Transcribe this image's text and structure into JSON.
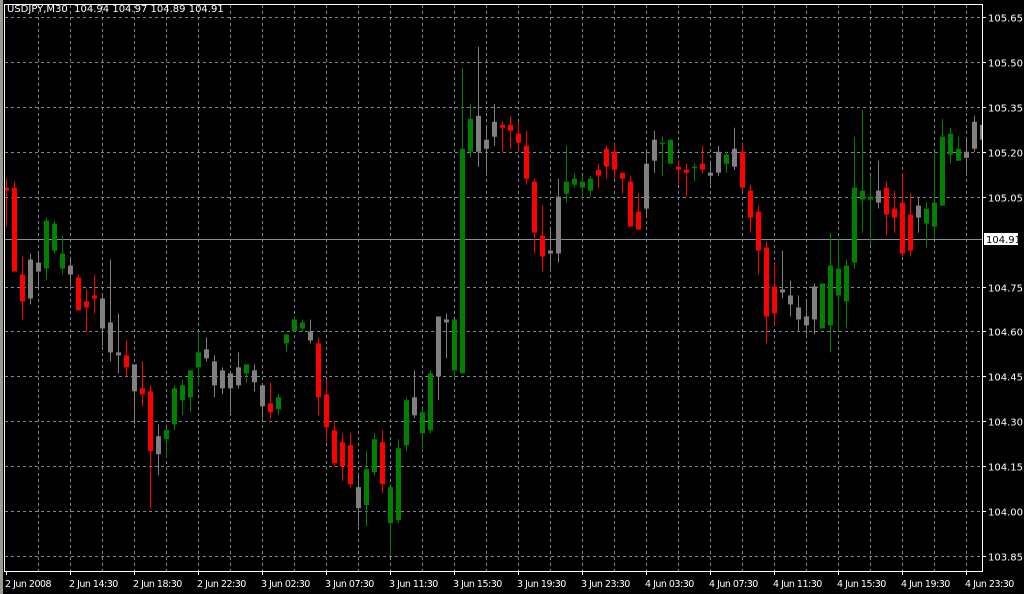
{
  "header": {
    "symbol": "USDJPY,M30",
    "open": "104.94",
    "high": "104.97",
    "low": "104.89",
    "close": "104.91"
  },
  "colors": {
    "bg": "#000000",
    "grid": "#778899",
    "frame": "#ffffff",
    "bull": "#008000",
    "bear": "#ff0000",
    "neutral": "#808080",
    "bid_line": "#8090a0"
  },
  "chart_data": {
    "type": "candlestick",
    "title": "USDJPY,M30",
    "ylim": [
      103.8,
      105.69
    ],
    "y_ticks": [
      "105.65",
      "105.50",
      "105.35",
      "105.20",
      "105.05",
      "104.75",
      "104.60",
      "104.45",
      "104.30",
      "104.15",
      "104.00",
      "103.85"
    ],
    "y_tick_values": [
      105.65,
      105.5,
      105.35,
      105.2,
      105.05,
      104.75,
      104.6,
      104.45,
      104.3,
      104.15,
      104.0,
      103.85
    ],
    "current_price": {
      "label": "104.91",
      "value": 104.91
    },
    "x_labels": [
      "2 Jun 2008",
      "2 Jun 14:30",
      "2 Jun 18:30",
      "2 Jun 22:30",
      "3 Jun 02:30",
      "3 Jun 07:30",
      "3 Jun 11:30",
      "3 Jun 15:30",
      "3 Jun 19:30",
      "3 Jun 23:30",
      "4 Jun 03:30",
      "4 Jun 07:30",
      "4 Jun 11:30",
      "4 Jun 15:30",
      "4 Jun 19:30",
      "4 Jun 23:30"
    ],
    "bars_per_label": 8,
    "grid": true,
    "candle_fields": [
      "open",
      "high",
      "low",
      "close",
      "color"
    ],
    "candles": [
      [
        105.08,
        105.11,
        104.95,
        105.07,
        "r"
      ],
      [
        105.08,
        105.1,
        104.8,
        104.8,
        "r"
      ],
      [
        104.79,
        104.85,
        104.64,
        104.7,
        "r"
      ],
      [
        104.84,
        104.86,
        104.69,
        104.71,
        "n"
      ],
      [
        104.83,
        104.86,
        104.75,
        104.8,
        "n"
      ],
      [
        104.81,
        104.98,
        104.77,
        104.97,
        "g"
      ],
      [
        104.87,
        104.97,
        104.86,
        104.96,
        "g"
      ],
      [
        104.81,
        104.92,
        104.79,
        104.86,
        "g"
      ],
      [
        104.82,
        104.84,
        104.75,
        104.79,
        "n"
      ],
      [
        104.78,
        104.79,
        104.67,
        104.67,
        "r"
      ],
      [
        104.7,
        104.74,
        104.6,
        104.68,
        "r"
      ],
      [
        104.72,
        104.79,
        104.66,
        104.71,
        "r"
      ],
      [
        104.71,
        104.72,
        104.55,
        104.61,
        "n"
      ],
      [
        104.63,
        104.84,
        104.5,
        104.53,
        "n"
      ],
      [
        104.53,
        104.66,
        104.46,
        104.52,
        "n"
      ],
      [
        104.52,
        104.57,
        104.45,
        104.48,
        "r"
      ],
      [
        104.49,
        104.49,
        104.29,
        104.4,
        "n"
      ],
      [
        104.41,
        104.5,
        104.35,
        104.39,
        "r"
      ],
      [
        104.4,
        104.42,
        104.01,
        104.2,
        "r"
      ],
      [
        104.25,
        104.29,
        104.12,
        104.19,
        "n"
      ],
      [
        104.24,
        104.28,
        104.18,
        104.27,
        "g"
      ],
      [
        104.29,
        104.42,
        104.27,
        104.41,
        "g"
      ],
      [
        104.37,
        104.44,
        104.32,
        104.42,
        "g"
      ],
      [
        104.38,
        104.47,
        104.33,
        104.47,
        "g"
      ],
      [
        104.48,
        104.6,
        104.42,
        104.53,
        "g"
      ],
      [
        104.54,
        104.58,
        104.5,
        104.51,
        "n"
      ],
      [
        104.5,
        104.52,
        104.38,
        104.42,
        "n"
      ],
      [
        104.47,
        104.48,
        104.39,
        104.41,
        "n"
      ],
      [
        104.46,
        104.46,
        104.33,
        104.41,
        "n"
      ],
      [
        104.48,
        104.53,
        104.41,
        104.42,
        "n"
      ],
      [
        104.46,
        104.49,
        104.43,
        104.49,
        "g"
      ],
      [
        104.47,
        104.49,
        104.4,
        104.43,
        "n"
      ],
      [
        104.42,
        104.42,
        104.31,
        104.35,
        "n"
      ],
      [
        104.36,
        104.43,
        104.31,
        104.33,
        "r"
      ],
      [
        104.34,
        104.39,
        104.32,
        104.38,
        "g"
      ],
      [
        104.56,
        104.59,
        104.53,
        104.59,
        "g"
      ],
      [
        104.6,
        104.65,
        104.6,
        104.64,
        "g"
      ],
      [
        104.61,
        104.64,
        104.6,
        104.63,
        "g"
      ],
      [
        104.6,
        104.64,
        104.56,
        104.57,
        "n"
      ],
      [
        104.56,
        104.58,
        104.32,
        104.38,
        "r"
      ],
      [
        104.39,
        104.44,
        104.23,
        104.28,
        "r"
      ],
      [
        104.27,
        104.3,
        104.15,
        104.16,
        "r"
      ],
      [
        104.23,
        104.26,
        104.1,
        104.15,
        "r"
      ],
      [
        104.22,
        104.26,
        104.08,
        104.09,
        "r"
      ],
      [
        104.08,
        104.12,
        103.95,
        104.01,
        "n"
      ],
      [
        104.02,
        104.2,
        103.95,
        104.14,
        "g"
      ],
      [
        104.13,
        104.26,
        104.12,
        104.24,
        "g"
      ],
      [
        104.23,
        104.27,
        104.06,
        104.09,
        "r"
      ],
      [
        103.96,
        104.08,
        103.85,
        104.08,
        "g"
      ],
      [
        103.97,
        104.24,
        103.96,
        104.21,
        "g"
      ],
      [
        104.22,
        104.38,
        104.2,
        104.37,
        "g"
      ],
      [
        104.38,
        104.47,
        104.31,
        104.32,
        "n"
      ],
      [
        104.26,
        104.35,
        104.2,
        104.33,
        "g"
      ],
      [
        104.27,
        104.47,
        104.26,
        104.46,
        "g"
      ],
      [
        104.65,
        104.65,
        104.37,
        104.45,
        "n"
      ],
      [
        104.64,
        104.66,
        104.51,
        104.63,
        "n"
      ],
      [
        104.47,
        104.64,
        104.44,
        104.64,
        "g"
      ],
      [
        104.46,
        105.48,
        104.46,
        105.21,
        "g"
      ],
      [
        105.2,
        105.36,
        105.18,
        105.31,
        "g"
      ],
      [
        105.32,
        105.55,
        105.15,
        105.2,
        "n"
      ],
      [
        105.24,
        105.28,
        105.13,
        105.21,
        "n"
      ],
      [
        105.3,
        105.36,
        105.22,
        105.25,
        "n"
      ],
      [
        105.29,
        105.3,
        105.2,
        105.28,
        "r"
      ],
      [
        105.29,
        105.32,
        105.21,
        105.27,
        "r"
      ],
      [
        105.26,
        105.3,
        105.2,
        105.23,
        "r"
      ],
      [
        105.22,
        105.27,
        105.09,
        105.11,
        "r"
      ],
      [
        105.1,
        105.11,
        104.86,
        104.93,
        "r"
      ],
      [
        104.92,
        105.02,
        104.8,
        104.85,
        "r"
      ],
      [
        104.87,
        104.94,
        104.81,
        104.86,
        "n"
      ],
      [
        105.05,
        105.11,
        104.83,
        104.86,
        "n"
      ],
      [
        105.06,
        105.22,
        105.03,
        105.1,
        "g"
      ],
      [
        105.09,
        105.13,
        105.08,
        105.11,
        "g"
      ],
      [
        105.08,
        105.12,
        105.04,
        105.1,
        "g"
      ],
      [
        105.07,
        105.12,
        105.05,
        105.11,
        "g"
      ],
      [
        105.14,
        105.16,
        105.08,
        105.12,
        "r"
      ],
      [
        105.21,
        105.22,
        105.11,
        105.15,
        "r"
      ],
      [
        105.2,
        105.23,
        105.11,
        105.14,
        "r"
      ],
      [
        105.13,
        105.13,
        105.06,
        105.11,
        "r"
      ],
      [
        105.1,
        105.12,
        104.95,
        104.95,
        "r"
      ],
      [
        105.0,
        105.06,
        104.94,
        104.94,
        "r"
      ],
      [
        105.16,
        105.2,
        104.99,
        105.01,
        "n"
      ],
      [
        105.24,
        105.27,
        105.13,
        105.17,
        "n"
      ],
      [
        105.23,
        105.25,
        105.12,
        105.23,
        "g"
      ],
      [
        105.16,
        105.24,
        105.16,
        105.24,
        "g"
      ],
      [
        105.15,
        105.17,
        105.09,
        105.14,
        "r"
      ],
      [
        105.14,
        105.16,
        105.05,
        105.13,
        "r"
      ],
      [
        105.15,
        105.16,
        105.1,
        105.15,
        "g"
      ],
      [
        105.16,
        105.22,
        105.13,
        105.14,
        "r"
      ],
      [
        105.13,
        105.16,
        105.09,
        105.12,
        "n"
      ],
      [
        105.2,
        105.22,
        105.12,
        105.13,
        "n"
      ],
      [
        105.16,
        105.2,
        105.13,
        105.19,
        "g"
      ],
      [
        105.21,
        105.28,
        105.14,
        105.15,
        "n"
      ],
      [
        105.2,
        105.23,
        105.07,
        105.08,
        "r"
      ],
      [
        105.07,
        105.09,
        104.93,
        104.98,
        "r"
      ],
      [
        105.0,
        105.02,
        104.79,
        104.87,
        "r"
      ],
      [
        104.88,
        104.9,
        104.56,
        104.65,
        "r"
      ],
      [
        104.75,
        104.83,
        104.62,
        104.66,
        "r"
      ],
      [
        104.74,
        104.87,
        104.71,
        104.73,
        "n"
      ],
      [
        104.72,
        104.77,
        104.65,
        104.69,
        "n"
      ],
      [
        104.68,
        104.72,
        104.6,
        104.64,
        "n"
      ],
      [
        104.65,
        104.7,
        104.59,
        104.62,
        "n"
      ],
      [
        104.75,
        104.76,
        104.59,
        104.64,
        "n"
      ],
      [
        104.61,
        104.76,
        104.61,
        104.76,
        "g"
      ],
      [
        104.62,
        104.93,
        104.53,
        104.82,
        "g"
      ],
      [
        104.72,
        104.91,
        104.6,
        104.81,
        "g"
      ],
      [
        104.7,
        104.84,
        104.61,
        104.82,
        "g"
      ],
      [
        104.83,
        105.25,
        104.81,
        105.08,
        "g"
      ],
      [
        105.04,
        105.34,
        104.93,
        105.07,
        "g"
      ],
      [
        105.04,
        105.12,
        104.89,
        105.05,
        "g"
      ],
      [
        105.07,
        105.17,
        105.01,
        105.03,
        "n"
      ],
      [
        105.08,
        105.1,
        104.92,
        104.99,
        "r"
      ],
      [
        105.01,
        105.07,
        104.93,
        104.98,
        "r"
      ],
      [
        105.03,
        105.13,
        104.85,
        104.86,
        "r"
      ],
      [
        104.99,
        105.06,
        104.85,
        104.87,
        "r"
      ],
      [
        105.02,
        105.05,
        104.93,
        104.98,
        "n"
      ],
      [
        104.96,
        105.03,
        104.88,
        105.01,
        "g"
      ],
      [
        104.95,
        105.2,
        104.91,
        105.03,
        "g"
      ],
      [
        105.02,
        105.31,
        105.02,
        105.25,
        "g"
      ],
      [
        105.19,
        105.28,
        105.16,
        105.26,
        "g"
      ],
      [
        105.17,
        105.25,
        105.17,
        105.21,
        "g"
      ],
      [
        105.2,
        105.24,
        105.13,
        105.18,
        "n"
      ],
      [
        105.3,
        105.32,
        105.2,
        105.21,
        "n"
      ],
      [
        105.29,
        105.32,
        105.2,
        105.24,
        "n"
      ]
    ]
  }
}
